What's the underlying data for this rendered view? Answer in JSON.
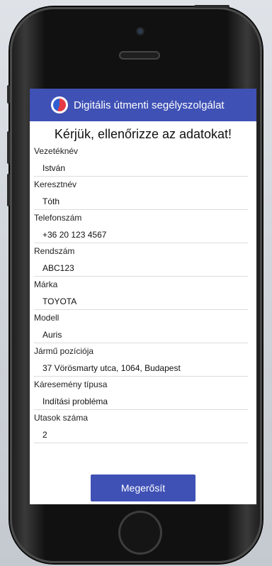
{
  "app": {
    "title": "Digitális útmenti segélyszolgálat",
    "logo_icon": "roadside-assist-logo-icon",
    "header_color": "#3f51b5"
  },
  "page": {
    "heading": "Kérjük, ellenőrizze az adatokat!"
  },
  "fields": [
    {
      "label": "Vezetéknév",
      "value": "István"
    },
    {
      "label": "Keresztnév",
      "value": "Tóth"
    },
    {
      "label": "Telefonszám",
      "value": "+36 20 123 4567"
    },
    {
      "label": "Rendszám",
      "value": "ABC123"
    },
    {
      "label": "Márka",
      "value": "TOYOTA"
    },
    {
      "label": "Modell",
      "value": "Auris"
    },
    {
      "label": "Jármű pozíciója",
      "value": "37 Vörösmarty utca, 1064, Budapest"
    },
    {
      "label": "Káresemény típusa",
      "value": "Indítási probléma"
    },
    {
      "label": "Utasok száma",
      "value": "2"
    }
  ],
  "actions": {
    "confirm_label": "Megerősít"
  }
}
